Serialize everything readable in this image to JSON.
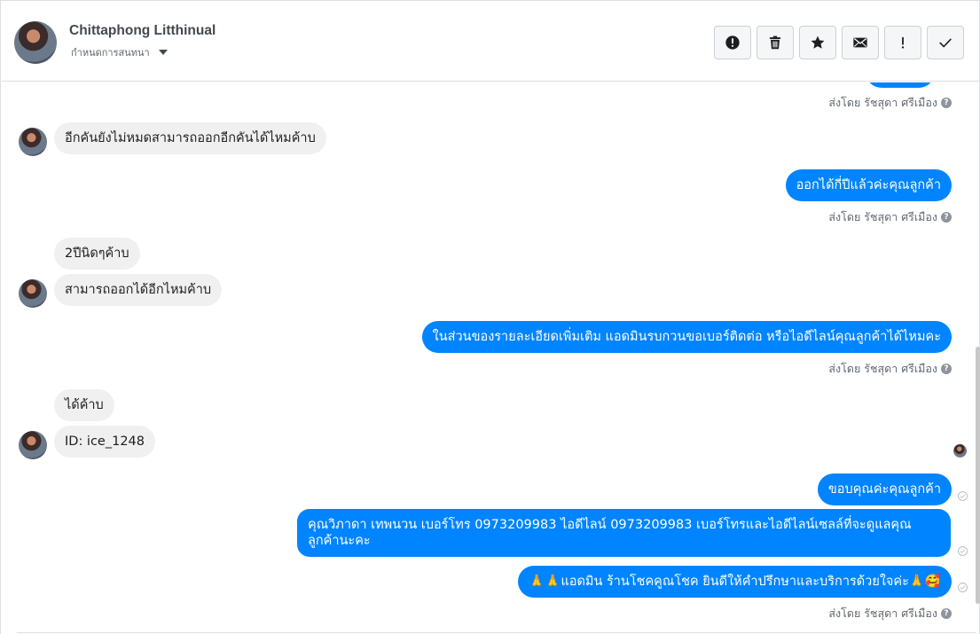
{
  "header": {
    "name": "Chittaphong Litthinual",
    "subtitle": "กำหนดการสนทนา",
    "actions": [
      {
        "name": "report-button",
        "icon": "alert-circle-icon"
      },
      {
        "name": "delete-button",
        "icon": "trash-icon"
      },
      {
        "name": "star-button",
        "icon": "star-icon"
      },
      {
        "name": "mark-unread-button",
        "icon": "envelope-icon"
      },
      {
        "name": "important-button",
        "icon": "exclamation-icon"
      },
      {
        "name": "mark-done-button",
        "icon": "check-icon"
      }
    ]
  },
  "messages": {
    "sent_by_label": "ส่งโดย รัชสุดา ศรีเมือง",
    "m1": "อีกคันยังไม่หมดสามารถออกอีกคันได้ไหมค้าบ",
    "m2": "ออกได้กี่ปีแล้วค่ะคุณลูกค้า",
    "m3": "2ปีนิดๆค้าบ",
    "m4": "สามารถออกได้อีกไหมค้าบ",
    "m5": "ในส่วนของรายละเอียดเพิ่มเติม แอดมินรบกวนขอเบอร์ติดต่อ หรือไอดีไลน์คุณลูกค้าได้ไหมคะ",
    "m6": "ได้ค้าบ",
    "m7": "ID: ice_1248",
    "m8": "ขอบคุณค่ะคุณลูกค้า",
    "m9": "คุณวิภาดา เทพนวน        เบอร์โทร 0973209983  ไอดีไลน์ 0973209983   เบอร์โทรและไอดีไลน์เซลล์ที่จะดูแลคุณลูกค้านะคะ",
    "m10": "🙏🙏แอดมิน ร้านโชคคูณโชค ยินดีให้คำปรึกษาและบริการด้วยใจค่ะ🙏🥰"
  },
  "colors": {
    "outgoing_bubble": "#0084ff",
    "incoming_bubble": "#f0f0f0"
  }
}
